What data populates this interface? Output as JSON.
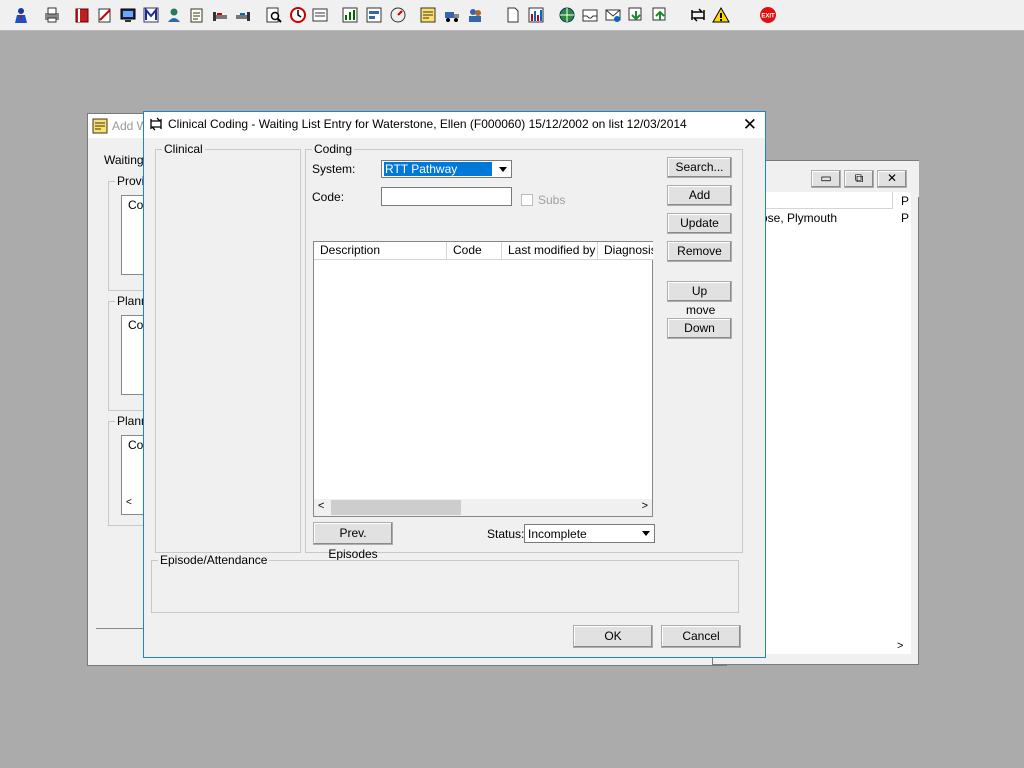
{
  "toolbar": {
    "icons": [
      "user-icon",
      "printer-icon",
      "book-icon",
      "notes-icon",
      "monitor-icon",
      "m-icon",
      "person-icon",
      "edit-icon",
      "bed-icon",
      "bed2-icon",
      "search-doc-icon",
      "clock-icon",
      "list-icon",
      "chart-icon",
      "form-icon",
      "dial-icon",
      "notepad-icon",
      "truck-icon",
      "user-group-icon",
      "document-icon",
      "bar-chart-icon",
      "globe-icon",
      "inbox-icon",
      "mail-icon",
      "download-icon",
      "upload-icon",
      "swap-icon",
      "warning-icon",
      "exit-icon"
    ],
    "exit_label": "EXIT"
  },
  "bg_window_left": {
    "title": "Add W",
    "tab": "Waiting",
    "group1": "Provis",
    "group2": "Plann",
    "group3": "Plann",
    "col": "Co"
  },
  "bg_window_right": {
    "row_text": "ose, Plymouth",
    "col_p": "P",
    "row_p": "P"
  },
  "dialog": {
    "title": "Clinical Coding - Waiting List Entry for Waterstone, Ellen (F000060) 15/12/2002 on list 12/03/2014",
    "clinical_legend": "Clinical",
    "coding_legend": "Coding",
    "system_label": "System:",
    "system_value": "RTT Pathway",
    "code_label": "Code:",
    "code_value": "",
    "subs_label": "Subs",
    "columns": [
      "Description",
      "Code",
      "Last modified by",
      "Diagnosis"
    ],
    "buttons": {
      "search": "Search...",
      "add": "Add",
      "update": "Update",
      "remove": "Remove",
      "up": "Up",
      "move": "move",
      "down": "Down",
      "prev_episodes": "Prev. Episodes",
      "ok": "OK",
      "cancel": "Cancel"
    },
    "status_label": "Status:",
    "status_value": "Incomplete",
    "episode_legend": "Episode/Attendance"
  }
}
